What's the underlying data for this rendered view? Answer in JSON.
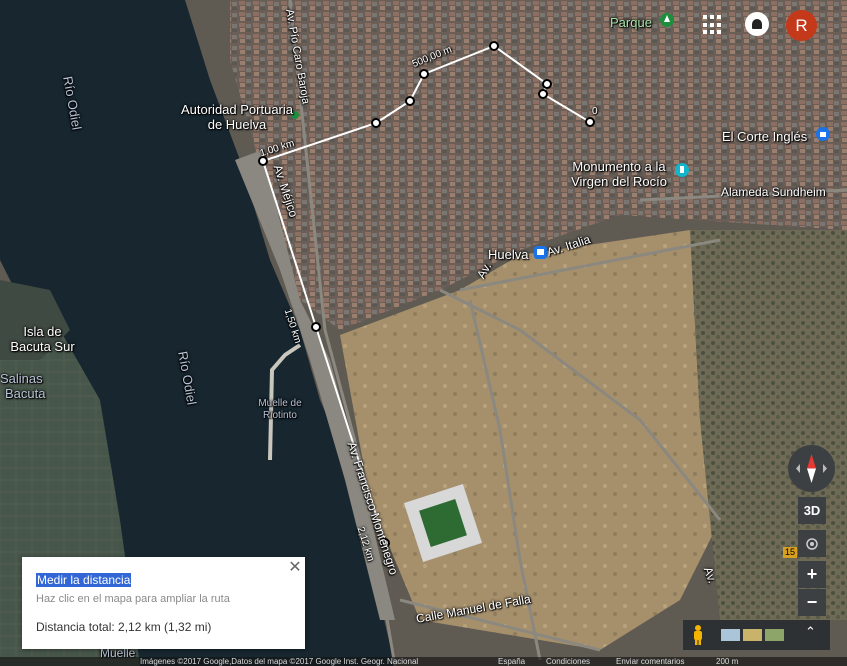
{
  "map": {
    "water_labels": [
      "Río Odiel",
      "Río Odiel"
    ],
    "place_labels": {
      "autoridad": [
        "Autoridad Portuaria",
        "de Huelva"
      ],
      "isla": [
        "Isla de",
        "Bacuta Sur"
      ],
      "salinas": [
        "Salinas",
        "Bacuta"
      ],
      "muelle": [
        "Muelle de",
        "Riotinto"
      ],
      "parque": "Parque",
      "corte": "El Corte Inglés",
      "monumento": [
        "Monumento a la",
        "Virgen del Rocío"
      ],
      "huelva": "Huelva"
    },
    "street_labels": {
      "caro": "Av. Pío Caro Baroja",
      "mejico": "Av. Méjico",
      "alameda": "Alameda Sundheim",
      "italia": "Av. Italia",
      "av": "Av.",
      "montenegro": "Av. Francisco Montenegro",
      "manuel": "Calle Manuel de Falla",
      "road_top": "Av.",
      "road_num": "15",
      "sept": "Av.",
      "muelle_top": "Muelle"
    },
    "measure_labels": [
      "500,00 m",
      "0",
      "1,00 km",
      "1,50 km",
      "2,12 km"
    ],
    "colors": {
      "water": "#17262f",
      "land": "#5d5850",
      "sand": "#b39a73",
      "path": "#ffffff",
      "poi_green": "#1e8e3e",
      "poi_blue": "#1a73e8",
      "poi_teal": "#12b5cb"
    }
  },
  "header": {
    "apps_icon": "apps-grid-icon",
    "notifications_icon": "notifications-icon",
    "avatar_letter": "R",
    "avatar_color": "#c5391b"
  },
  "measure_panel": {
    "title": "Medir la distancia",
    "hint": "Haz clic en el mapa para ampliar la ruta",
    "total": "Distancia total: 2,12 km (1,32 mi)"
  },
  "controls": {
    "tilt_label": "3D",
    "zoom_in": "+",
    "zoom_out": "−"
  },
  "footer": {
    "attribution": "Imágenes ©2017 Google,Datos del mapa ©2017 Google Inst. Geogr. Nacional",
    "country": "España",
    "terms": "Condiciones",
    "feedback": "Enviar comentarios",
    "scale": "200 m"
  }
}
